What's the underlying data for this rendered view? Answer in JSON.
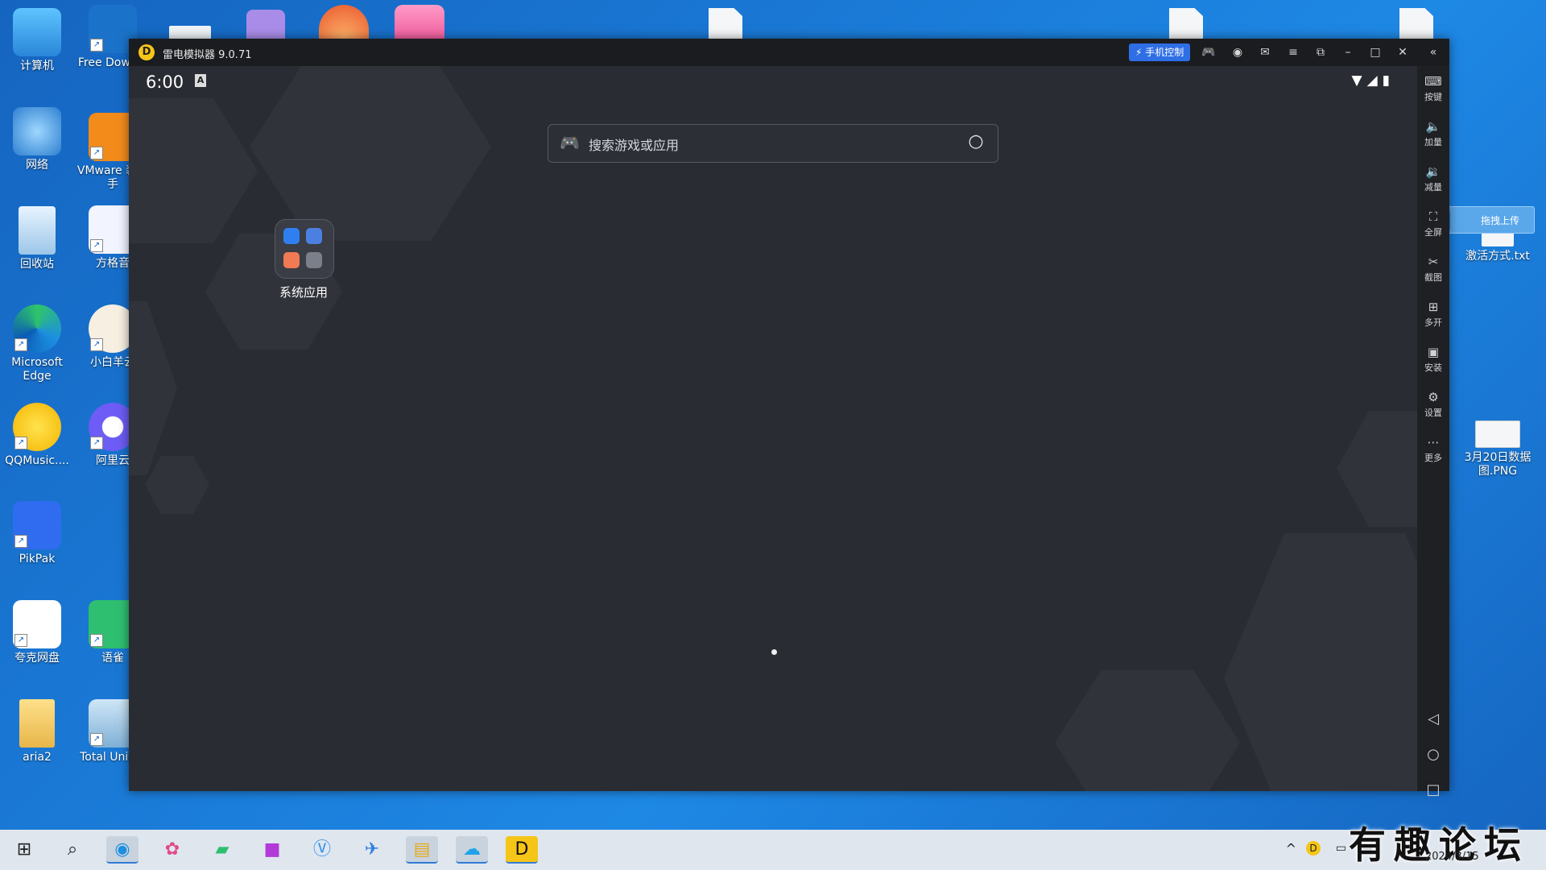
{
  "desktop": {
    "icons_left": [
      {
        "label": "计算机",
        "icon": "computer-icon"
      },
      {
        "label": "网络",
        "icon": "network-icon"
      },
      {
        "label": "回收站",
        "icon": "recycle-bin-icon"
      },
      {
        "label": "Microsoft Edge",
        "icon": "edge-icon"
      },
      {
        "label": "QQMusic....",
        "icon": "qqmusic-icon"
      },
      {
        "label": "PikPak",
        "icon": "pikpak-icon"
      },
      {
        "label": "夸克网盘",
        "icon": "quark-drive-icon"
      },
      {
        "label": "aria2",
        "icon": "folder-icon"
      }
    ],
    "icons_second": [
      {
        "label": "Free Downlo",
        "icon": "free-download-icon"
      },
      {
        "label": "VMware 装助手",
        "icon": "vmware-icon"
      },
      {
        "label": "方格音",
        "icon": "audio-icon"
      },
      {
        "label": "小白羊云",
        "icon": "sheep-icon"
      },
      {
        "label": "阿里云",
        "icon": "aliyun-icon"
      },
      {
        "label": "语雀",
        "icon": "yuque-icon"
      },
      {
        "label": "Total Uninst",
        "icon": "uninstaller-icon"
      }
    ],
    "icons_right": [
      {
        "label": "激活方式.txt",
        "icon": "text-file-icon"
      },
      {
        "label": "3月20日数据图.PNG",
        "icon": "image-file-icon"
      }
    ]
  },
  "emulator": {
    "title": "雷电模拟器 9.0.71",
    "phone_control": "手机控制",
    "status_time": "6:00",
    "status_a": "A",
    "search_placeholder": "搜索游戏或应用",
    "folder_label": "系统应用",
    "sidebar": [
      {
        "label": "按键",
        "icon": "keyboard-icon"
      },
      {
        "label": "加量",
        "icon": "volume-up-icon"
      },
      {
        "label": "减量",
        "icon": "volume-down-icon"
      },
      {
        "label": "全屏",
        "icon": "fullscreen-icon"
      },
      {
        "label": "截图",
        "icon": "scissors-icon"
      },
      {
        "label": "多开",
        "icon": "multi-instance-icon"
      },
      {
        "label": "安装",
        "icon": "apk-install-icon"
      },
      {
        "label": "设置",
        "icon": "settings-icon"
      },
      {
        "label": "更多",
        "icon": "more-icon"
      }
    ]
  },
  "upload": {
    "label": "拖拽上传"
  },
  "taskbar": {
    "date": "2024/3/15",
    "watermark": "有趣论坛"
  }
}
